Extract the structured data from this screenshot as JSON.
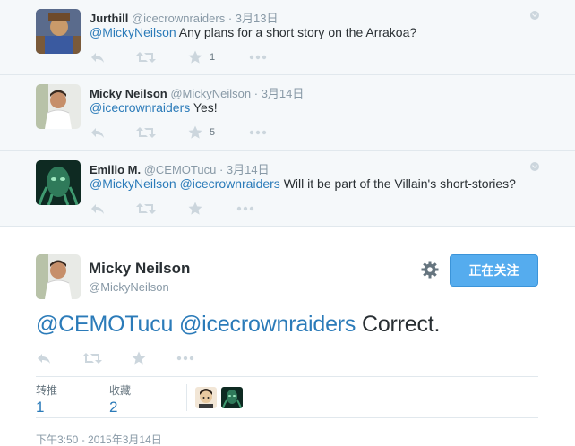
{
  "replies": [
    {
      "name": "Jurthill",
      "handle": "@icecrownraiders",
      "time": "3月13日",
      "mention": "@MickyNeilson",
      "body": " Any plans for a short story on the Arrakoa?",
      "favorite_count": "1"
    },
    {
      "name": "Micky Neilson",
      "handle": "@MickyNeilson",
      "time": "3月14日",
      "mention": "@icecrownraiders",
      "body": " Yes!",
      "favorite_count": "5"
    },
    {
      "name": "Emilio M.",
      "handle": "@CEMOTucu",
      "time": "3月14日",
      "mention": "@MickyNeilson @icecrownraiders",
      "body": " Will it be part of the Villain's short-stories?",
      "favorite_count": ""
    }
  ],
  "main_tweet": {
    "name": "Micky Neilson",
    "handle": "@MickyNeilson",
    "follow_label": "正在关注",
    "mention_1": "@CEMOTucu",
    "mention_2": "@icecrownraiders",
    "body": " Correct.",
    "retweets_label": "转推",
    "retweets_count": "1",
    "favorites_label": "收藏",
    "favorites_count": "2",
    "datetime": "下午3:50 - 2015年3月14日"
  },
  "icons": [
    "reply-icon",
    "retweet-icon",
    "favorite-icon",
    "more-icon",
    "gear-icon",
    "expand-icon"
  ],
  "colors": {
    "link": "#2b7bb9",
    "follow_button": "#55acee",
    "reply_background": "#f5f8fa",
    "action_icon": "#ccd6dd"
  }
}
